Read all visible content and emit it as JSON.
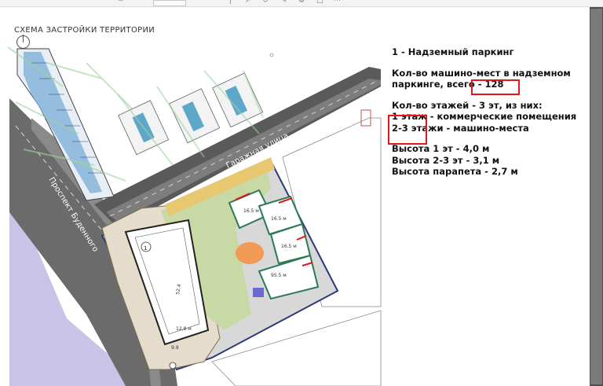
{
  "toolbar": {
    "zoom_value": ""
  },
  "sheet": {
    "title": "СХЕМА ЗАСТРОЙКИ ТЕРРИТОРИИ",
    "streets": {
      "garage": "Гаражная улица",
      "prospect": "Проспект Буденного"
    },
    "building_number": "1",
    "parking_label_top": "9.9",
    "parking_label_mid": "52.4",
    "parking_label_bottom": "12,8 м",
    "res_labels": [
      "16.5 м",
      "16.5 м",
      "16.5 м",
      "95.5 м"
    ]
  },
  "legend": {
    "line1": "1 - Надземный паркинг",
    "line2": "Кол-во машино-мест в надземном",
    "line3a": "паркинге, всего",
    "line3b": " - 128",
    "line4": "Кол-во этажей - 3 эт, из них:",
    "line5": "1 этаж - коммерческие помещения",
    "line6a": "2-3 этажи",
    "line6b": " - машино-места",
    "line7": "Высота 1 эт - 4,0 м",
    "line8": "Высота 2-3 эт - 3,1 м",
    "line9": "Высота парапета - 2,7 м"
  },
  "colors": {
    "highlight": "#e2161b",
    "road": "#5a5a5a",
    "plot_border": "#2d3a78",
    "water": "#c9c3e8"
  }
}
